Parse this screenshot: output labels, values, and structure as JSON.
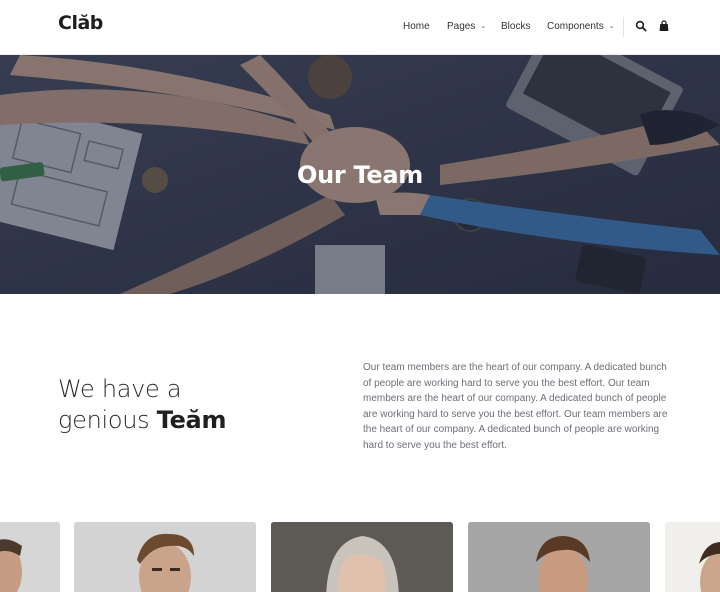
{
  "header": {
    "logo": "Clăb",
    "nav": [
      {
        "label": "Home",
        "dropdown": false
      },
      {
        "label": "Pages",
        "dropdown": true
      },
      {
        "label": "Blocks",
        "dropdown": false
      },
      {
        "label": "Components",
        "dropdown": true
      }
    ],
    "icons": [
      "search-icon",
      "shopping-bag-icon"
    ]
  },
  "hero": {
    "title": "Our Team"
  },
  "intro": {
    "heading_line1": "We have a",
    "heading_line2_plain": "genious ",
    "heading_line2_bold": "Teăm",
    "paragraph": "Our team members are the heart of our company. A dedicated bunch of people are working hard to serve you the best effort. Our team members are the heart of our company. A dedicated bunch of people are working hard to serve you the best effort. Our team members are the heart of our company. A dedicated bunch of people are working hard to serve you the best effort."
  },
  "colors": {
    "text_dark": "#1f1f1f",
    "text_muted": "#6b6f77",
    "hero_overlay": "#1e2438"
  }
}
